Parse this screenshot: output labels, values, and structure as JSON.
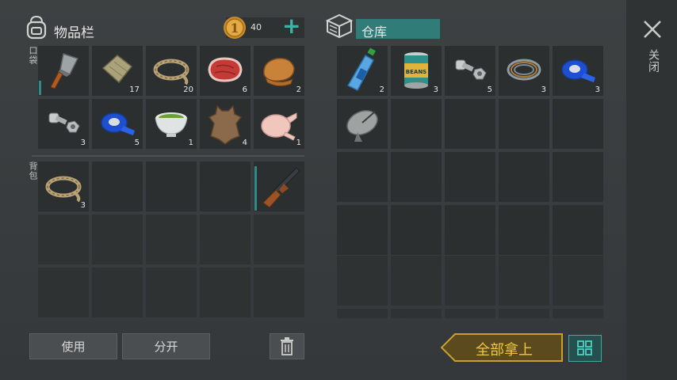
{
  "inventory": {
    "title": "物品栏",
    "coins": "40",
    "plus": "+",
    "pocket_label": "口袋",
    "backpack_label": "背包",
    "pocket_items": [
      {
        "icon": "cleaver-icon",
        "count": ""
      },
      {
        "icon": "cloth-icon",
        "count": "17"
      },
      {
        "icon": "rope-icon",
        "count": "20"
      },
      {
        "icon": "raw-meat-icon",
        "count": "6"
      },
      {
        "icon": "cooked-food-icon",
        "count": "2"
      },
      {
        "icon": "bolt-nut-icon",
        "count": "3"
      },
      {
        "icon": "blue-tape-icon",
        "count": "5"
      },
      {
        "icon": "green-tea-bowl-icon",
        "count": "1"
      },
      {
        "icon": "leather-hide-icon",
        "count": "4"
      },
      {
        "icon": "raw-chicken-icon",
        "count": "1"
      }
    ],
    "backpack_items": [
      {
        "icon": "rope-icon",
        "count": "3"
      },
      {
        "icon": "empty",
        "count": ""
      },
      {
        "icon": "empty",
        "count": ""
      },
      {
        "icon": "empty",
        "count": ""
      },
      {
        "icon": "shotgun-icon",
        "count": ""
      }
    ]
  },
  "storage": {
    "title": "仓库",
    "items": [
      {
        "icon": "water-bottle-icon",
        "count": "2"
      },
      {
        "icon": "beans-can-icon",
        "count": "3",
        "can_label": "BEANS"
      },
      {
        "icon": "bolt-nut-icon",
        "count": "5"
      },
      {
        "icon": "wire-coil-icon",
        "count": "3"
      },
      {
        "icon": "blue-tape-icon",
        "count": "3"
      },
      {
        "icon": "satellite-dish-icon",
        "count": ""
      }
    ]
  },
  "buttons": {
    "use": "使用",
    "split": "分开",
    "take_all": "全部拿上",
    "close": "关闭"
  },
  "colors": {
    "accent_teal": "#2f7c78",
    "take_all_gold": "#f0c640",
    "durability": "#2f8a8a"
  }
}
